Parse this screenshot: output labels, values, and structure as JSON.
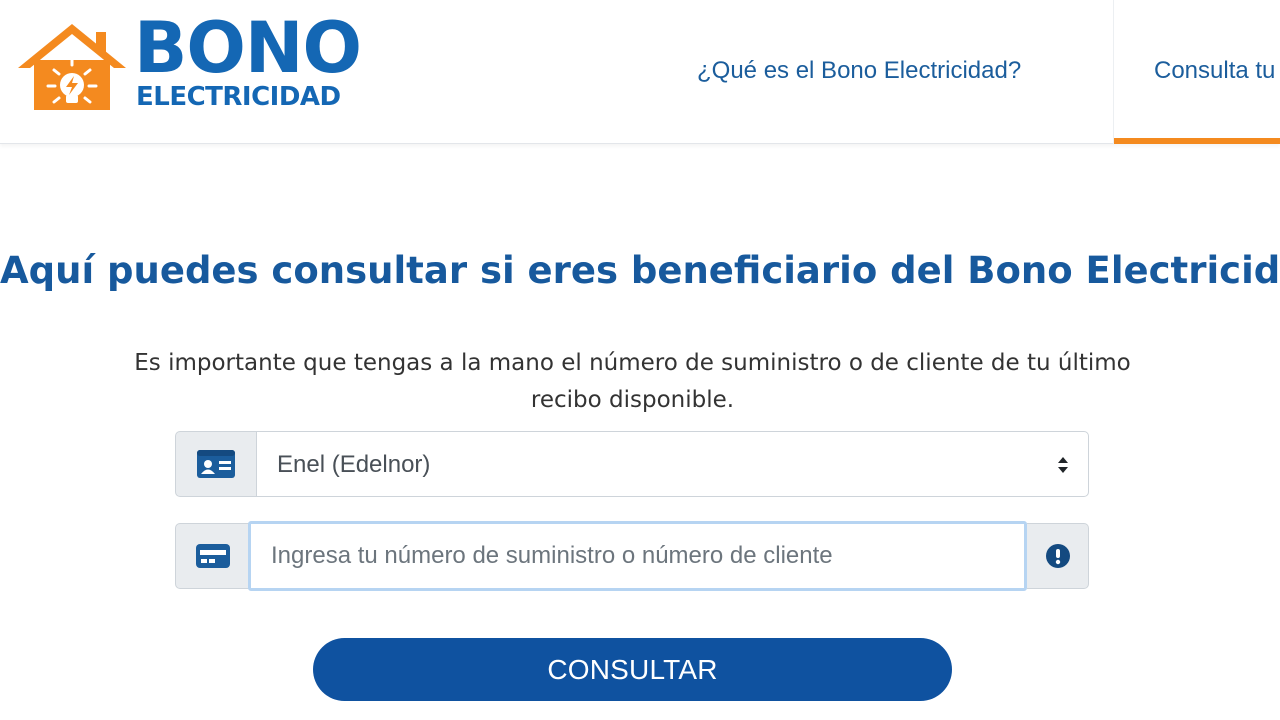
{
  "header": {
    "logo": {
      "word_1": "BONO",
      "word_2": "ELECTRICIDAD",
      "icon": "house-lightbulb-icon",
      "colors": {
        "house": "#f48a1f",
        "text": "#1467b4"
      }
    },
    "nav": [
      {
        "label": "¿Qué es el Bono Electricidad?",
        "active": false
      },
      {
        "label": "Consulta tu",
        "active": true
      }
    ],
    "active_underline_color": "#f48a1f"
  },
  "main": {
    "title": "Aquí puedes consultar si eres beneficiario del Bono Electricidad",
    "subtitle": "Es importante que tengas a la mano el número de suministro o de cliente de tu último recibo disponible.",
    "provider_select": {
      "icon": "id-card-icon",
      "selected": "Enel (Edelnor)",
      "arrow_icon": "sort-arrows-icon"
    },
    "supply_input": {
      "icon": "credit-card-icon",
      "value": "",
      "placeholder": "Ingresa tu número de suministro o número de cliente",
      "status_icon": "exclamation-circle-icon"
    },
    "submit_label": "CONSULTAR",
    "accent_color": "#0f52a0"
  }
}
